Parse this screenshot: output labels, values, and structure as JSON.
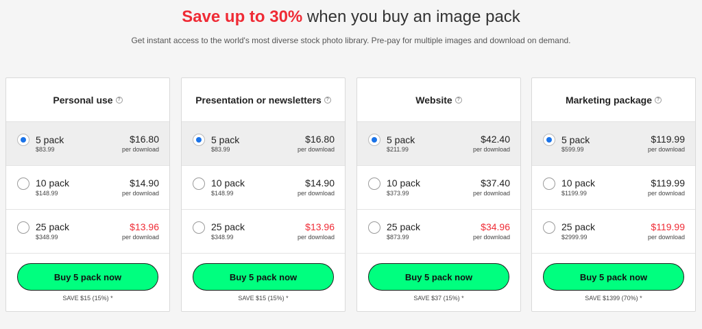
{
  "header": {
    "title_accent": "Save up to 30%",
    "title_rest": " when you buy an image pack",
    "subtitle": "Get instant access to the world's most diverse stock photo library. Pre-pay for multiple images and download on demand."
  },
  "colors": {
    "accent_red": "#ef2b35",
    "buy_button": "#00ff7f",
    "radio_selected": "#1a73e8"
  },
  "icons": {
    "help": "question-circle-icon",
    "radio_help_glyph": "?"
  },
  "cards": [
    {
      "title": "Personal use",
      "options": [
        {
          "pack": "5 pack",
          "total": "$83.99",
          "price": "$16.80",
          "per": "per download",
          "selected": true
        },
        {
          "pack": "10 pack",
          "total": "$148.99",
          "price": "$14.90",
          "per": "per download",
          "selected": false
        },
        {
          "pack": "25 pack",
          "total": "$348.99",
          "price": "$13.96",
          "per": "per download",
          "selected": false
        }
      ],
      "button": "Buy 5 pack now",
      "save": "SAVE $15 (15%) *"
    },
    {
      "title": "Presentation or newsletters",
      "options": [
        {
          "pack": "5 pack",
          "total": "$83.99",
          "price": "$16.80",
          "per": "per download",
          "selected": true
        },
        {
          "pack": "10 pack",
          "total": "$148.99",
          "price": "$14.90",
          "per": "per download",
          "selected": false
        },
        {
          "pack": "25 pack",
          "total": "$348.99",
          "price": "$13.96",
          "per": "per download",
          "selected": false
        }
      ],
      "button": "Buy 5 pack now",
      "save": "SAVE $15 (15%) *"
    },
    {
      "title": "Website",
      "options": [
        {
          "pack": "5 pack",
          "total": "$211.99",
          "price": "$42.40",
          "per": "per download",
          "selected": true
        },
        {
          "pack": "10 pack",
          "total": "$373.99",
          "price": "$37.40",
          "per": "per download",
          "selected": false
        },
        {
          "pack": "25 pack",
          "total": "$873.99",
          "price": "$34.96",
          "per": "per download",
          "selected": false
        }
      ],
      "button": "Buy 5 pack now",
      "save": "SAVE $37 (15%) *"
    },
    {
      "title": "Marketing package",
      "options": [
        {
          "pack": "5 pack",
          "total": "$599.99",
          "price": "$119.99",
          "per": "per download",
          "selected": true
        },
        {
          "pack": "10 pack",
          "total": "$1199.99",
          "price": "$119.99",
          "per": "per download",
          "selected": false
        },
        {
          "pack": "25 pack",
          "total": "$2999.99",
          "price": "$119.99",
          "per": "per download",
          "selected": false
        }
      ],
      "button": "Buy 5 pack now",
      "save": "SAVE $1399 (70%) *"
    }
  ]
}
